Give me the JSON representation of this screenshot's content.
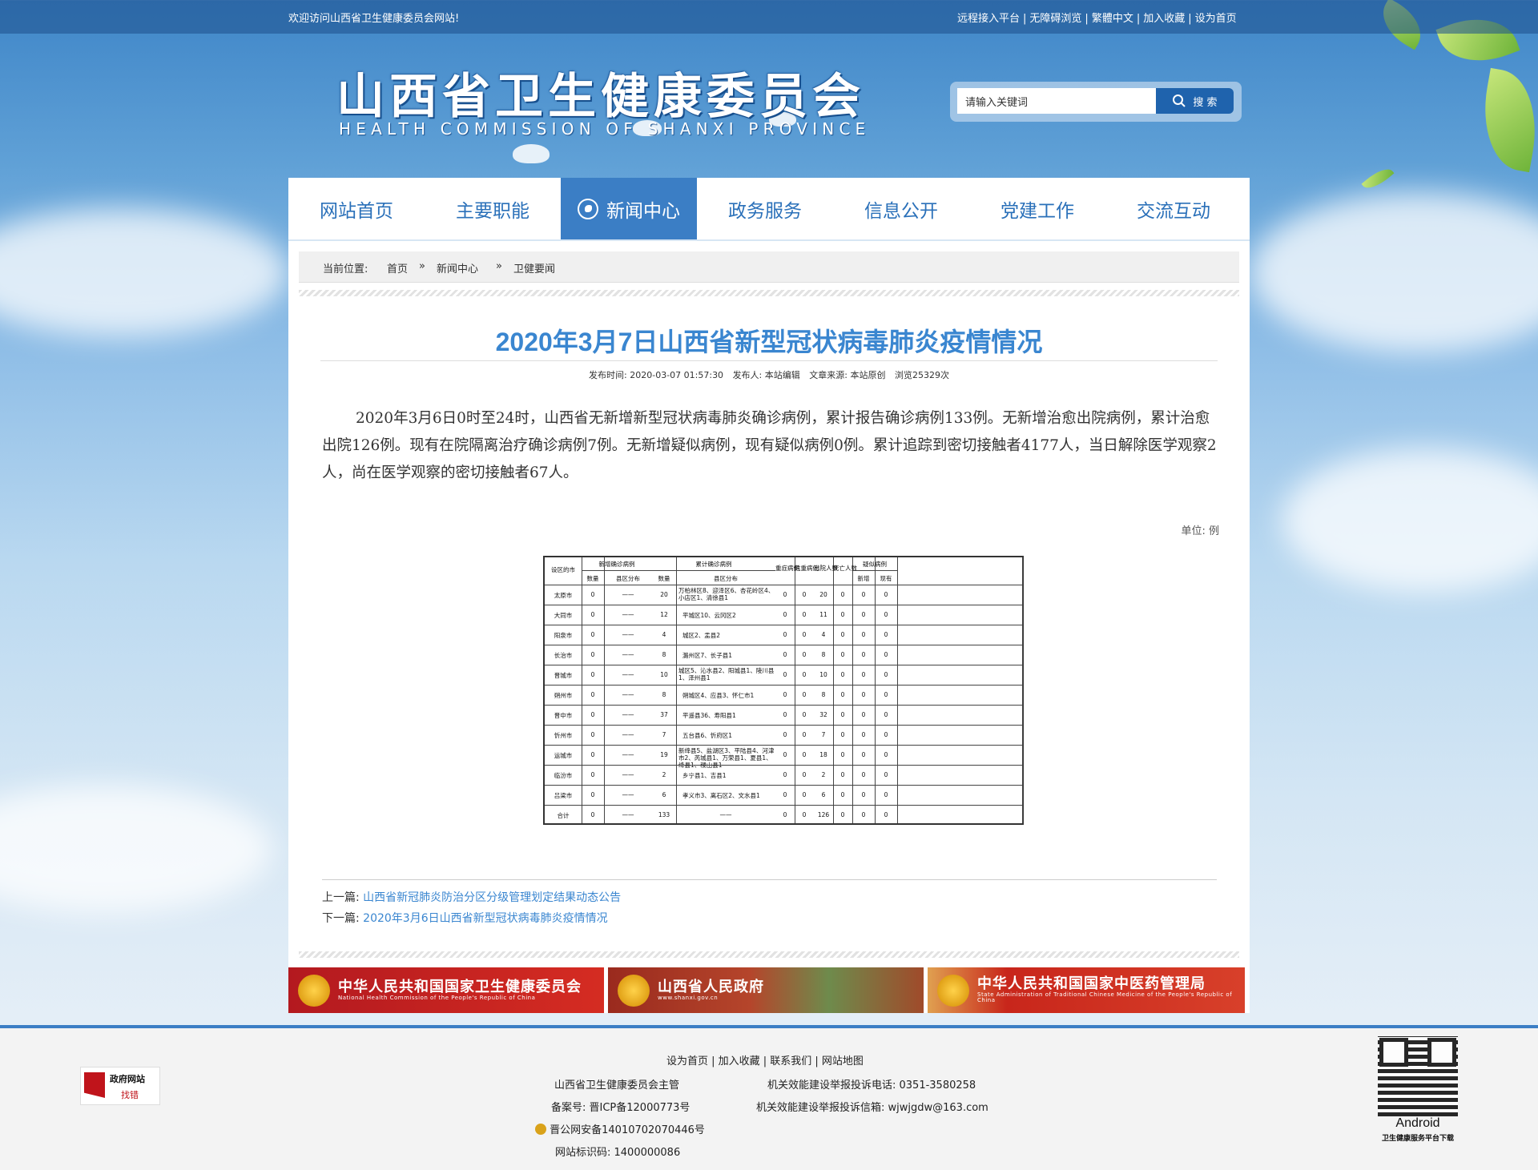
{
  "topbar": {
    "welcome": "欢迎访问山西省卫生健康委员会网站!",
    "links": [
      "远程接入平台",
      "无障碍浏览",
      "繁體中文",
      "加入收藏",
      "设为首页"
    ]
  },
  "logo": {
    "cn": "山西省卫生健康委员会",
    "en": "HEALTH COMMISSION OF SHANXI PROVINCE"
  },
  "search": {
    "placeholder": "请输入关键词",
    "button": "搜 索"
  },
  "nav": {
    "items": [
      "网站首页",
      "主要职能",
      "新闻中心",
      "政务服务",
      "信息公开",
      "党建工作",
      "交流互动"
    ],
    "active": "新闻中心"
  },
  "breadcrumb": {
    "label": "当前位置:",
    "items": [
      "首页",
      "新闻中心",
      "卫健要闻"
    ],
    "sep": "»"
  },
  "article": {
    "title": "2020年3月7日山西省新型冠状病毒肺炎疫情情况",
    "meta": {
      "publish_time": "发布时间: 2020-03-07 01:57:30",
      "publisher": "发布人: 本站编辑",
      "source": "文章来源: 本站原创",
      "views": "浏览25329次"
    },
    "body": "2020年3月6日0时至24时，山西省无新增新型冠状病毒肺炎确诊病例，累计报告确诊病例133例。无新增治愈出院病例，累计治愈出院126例。现有在院隔离治疗确诊病例7例。无新增疑似病例，现有疑似病例0例。累计追踪到密切接触者4177人，当日解除医学观察2人，尚在医学观察的密切接触者67人。",
    "unit": "单位: 例"
  },
  "table": {
    "header_top": [
      "设区的市",
      "新增确诊病例",
      "累计确诊病例",
      "重症病例",
      "危重病例",
      "出院人数",
      "死亡人数",
      "疑似病例"
    ],
    "header_sub": [
      "数量",
      "县区分布",
      "数量",
      "县区分布",
      "新增",
      "现有"
    ],
    "rows": [
      [
        "太原市",
        "0",
        "——",
        "20",
        "万柏林区8、迎泽区6、杏花岭区4、小店区1、清徐县1",
        "0",
        "0",
        "20",
        "0",
        "0",
        "0"
      ],
      [
        "大同市",
        "0",
        "——",
        "12",
        "平城区10、云冈区2",
        "0",
        "0",
        "11",
        "0",
        "0",
        "0"
      ],
      [
        "阳泉市",
        "0",
        "——",
        "4",
        "城区2、盂县2",
        "0",
        "0",
        "4",
        "0",
        "0",
        "0"
      ],
      [
        "长治市",
        "0",
        "——",
        "8",
        "潞州区7、长子县1",
        "0",
        "0",
        "8",
        "0",
        "0",
        "0"
      ],
      [
        "晋城市",
        "0",
        "——",
        "10",
        "城区5、沁水县2、阳城县1、陵川县1、泽州县1",
        "0",
        "0",
        "10",
        "0",
        "0",
        "0"
      ],
      [
        "朔州市",
        "0",
        "——",
        "8",
        "朔城区4、应县3、怀仁市1",
        "0",
        "0",
        "8",
        "0",
        "0",
        "0"
      ],
      [
        "晋中市",
        "0",
        "——",
        "37",
        "平遥县36、寿阳县1",
        "0",
        "0",
        "32",
        "0",
        "0",
        "0"
      ],
      [
        "忻州市",
        "0",
        "——",
        "7",
        "五台县6、忻府区1",
        "0",
        "0",
        "7",
        "0",
        "0",
        "0"
      ],
      [
        "运城市",
        "0",
        "——",
        "19",
        "新绛县5、盐湖区3、平陆县4、河津市2、芮城县1、万荣县1、夏县1、绛县1、稷山县1",
        "0",
        "0",
        "18",
        "0",
        "0",
        "0"
      ],
      [
        "临汾市",
        "0",
        "——",
        "2",
        "乡宁县1、吉县1",
        "0",
        "0",
        "2",
        "0",
        "0",
        "0"
      ],
      [
        "吕梁市",
        "0",
        "——",
        "6",
        "孝义市3、离石区2、文水县1",
        "0",
        "0",
        "6",
        "0",
        "0",
        "0"
      ],
      [
        "合计",
        "0",
        "——",
        "133",
        "——",
        "0",
        "0",
        "126",
        "0",
        "0",
        "0"
      ]
    ]
  },
  "prevnext": {
    "prev_label": "上一篇:",
    "prev_title": "山西省新冠肺炎防治分区分级管理划定结果动态公告",
    "next_label": "下一篇:",
    "next_title": "2020年3月6日山西省新型冠状病毒肺炎疫情情况"
  },
  "banners": [
    {
      "cn": "中华人民共和国国家卫生健康委员会",
      "en": "National Health Commission of the People's Republic of China",
      "color": "#b3191f"
    },
    {
      "cn": "山西省人民政府",
      "en": "www.shanxi.gov.cn",
      "color": "#a0261f"
    },
    {
      "cn": "中华人民共和国国家中医药管理局",
      "en": "State Administration of Traditional Chinese Medicine of the People's Republic of China",
      "color": "#c8261b"
    }
  ],
  "footer": {
    "links": "设为首页 | 加入收藏 | 联系我们 | 网站地图",
    "host": "山西省卫生健康委员会主管",
    "icp": "备案号: 晋ICP备12000773号",
    "police": "晋公网安备14010702070446号",
    "site_code": "网站标识码: 1400000086",
    "tel": "机关效能建设举报投诉电话: 0351-3580258",
    "mail": "机关效能建设举报投诉信箱: wjwjgdw@163.com",
    "badge_line1": "政府网站",
    "badge_line2": "找错",
    "qr_label": "Android",
    "qr_caption": "卫生健康服务平台下载"
  }
}
